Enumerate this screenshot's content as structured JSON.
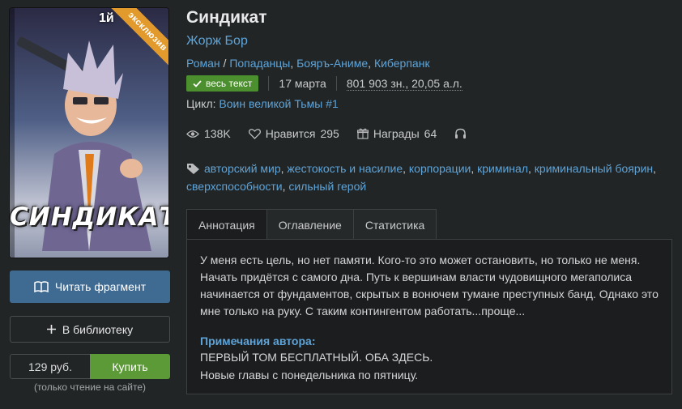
{
  "book": {
    "title": "Синдикат",
    "author": "Жорж Бор",
    "genres": [
      "Роман",
      "Попаданцы",
      "Бояръ-Аниме",
      "Киберпанк"
    ],
    "status_badge": "весь текст",
    "date": "17 марта",
    "size": "801 903 зн., 20,05 а.л.",
    "cycle_label": "Цикл:",
    "cycle_name": "Воин великой Тьмы #1"
  },
  "cover": {
    "title": "СИНДИКАТ",
    "top_text": "1й",
    "ribbon": "эксклюзив"
  },
  "stats": {
    "views": "138K",
    "likes_label": "Нравится",
    "likes": "295",
    "awards_label": "Награды",
    "awards": "64"
  },
  "tags": [
    "авторский мир",
    "жестокость и насилие",
    "корпорации",
    "криминал",
    "криминальный боярин",
    "сверхспособности",
    "сильный герой"
  ],
  "actions": {
    "read_fragment": "Читать фрагмент",
    "add_library": "В библиотеку",
    "price": "129 руб.",
    "buy": "Купить",
    "buy_note": "(только чтение на сайте)"
  },
  "tabs": [
    "Аннотация",
    "Оглавление",
    "Статистика"
  ],
  "annotation": {
    "text": "У меня есть цель, но нет памяти. Кого-то это может остановить, но только не меня. Начать придётся с самого дна. Путь к вершинам власти чудовищного мегаполиса начинается от фундаментов, скрытых в вонючем тумане преступных банд. Однако это мне только на руку. С таким контингентом работать...проще...",
    "notes_title": "Примечания автора:",
    "notes_line1": "ПЕРВЫЙ ТОМ БЕСПЛАТНЫЙ. ОБА ЗДЕСЬ.",
    "notes_line2": "Новые главы с понедельника по пятницу."
  },
  "colors": {
    "background": "#222526",
    "link": "#5ea4d8",
    "read_button": "#3f6a92",
    "buy_button": "#5b9a36",
    "badge": "#4c8f2f",
    "ribbon": "#e29a2c"
  }
}
